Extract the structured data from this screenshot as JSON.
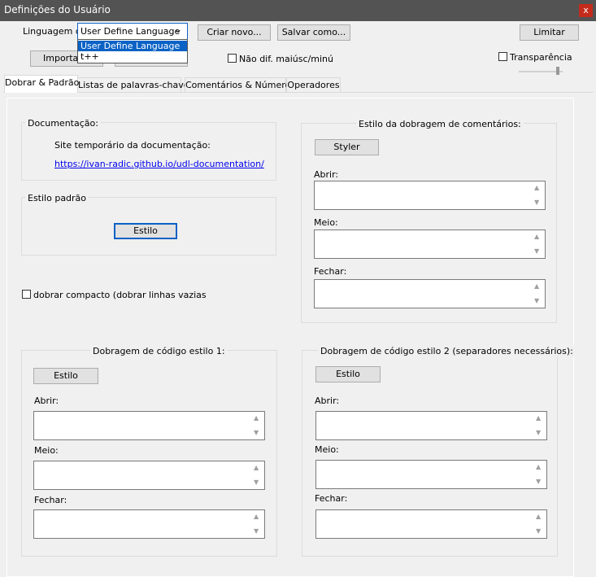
{
  "window": {
    "title": "Definições do Usuário",
    "close_glyph": "x"
  },
  "toolbar": {
    "language_label": "Linguagem do",
    "language_value": "User Define Language",
    "language_options": [
      "User Define Language",
      "t++"
    ],
    "create_new": "Criar novo...",
    "save_as": "Salvar como...",
    "limit": "Limitar",
    "import": "Importar",
    "case_insensitive": "Não dif. maiúsc/minú",
    "transparency": "Transparência"
  },
  "tabs": [
    "Dobrar & Padrão",
    "Listas de palavras-chave",
    "Comentários & Números",
    "Operadores"
  ],
  "documentation": {
    "group_label": "Documentação:",
    "site_label": "Site temporário da documentação:",
    "link": "https://ivan-radic.github.io/udl-documentation/"
  },
  "default_style": {
    "group_label": "Estilo padrão",
    "button": "Estilo"
  },
  "compact_fold": {
    "label": "dobrar compacto (dobrar linhas vazias tambe"
  },
  "comment_fold": {
    "group_label": "Estilo da dobragem de comentários:",
    "button": "Styler",
    "open": "Abrir:",
    "middle": "Meio:",
    "close": "Fechar:"
  },
  "code_fold_1": {
    "group_label": "Dobragem de código estilo 1:",
    "button": "Estilo",
    "open": "Abrir:",
    "middle": "Meio:",
    "close": "Fechar:"
  },
  "code_fold_2": {
    "group_label": "Dobragem de código estilo 2 (separadores necessários):",
    "button": "Estilo",
    "open": "Abrir:",
    "middle": "Meio:",
    "close": "Fechar:"
  },
  "colors": {
    "accent": "#0a62c5",
    "titlebar": "#535353",
    "close": "#c42b1c",
    "link": "#0000ee"
  }
}
